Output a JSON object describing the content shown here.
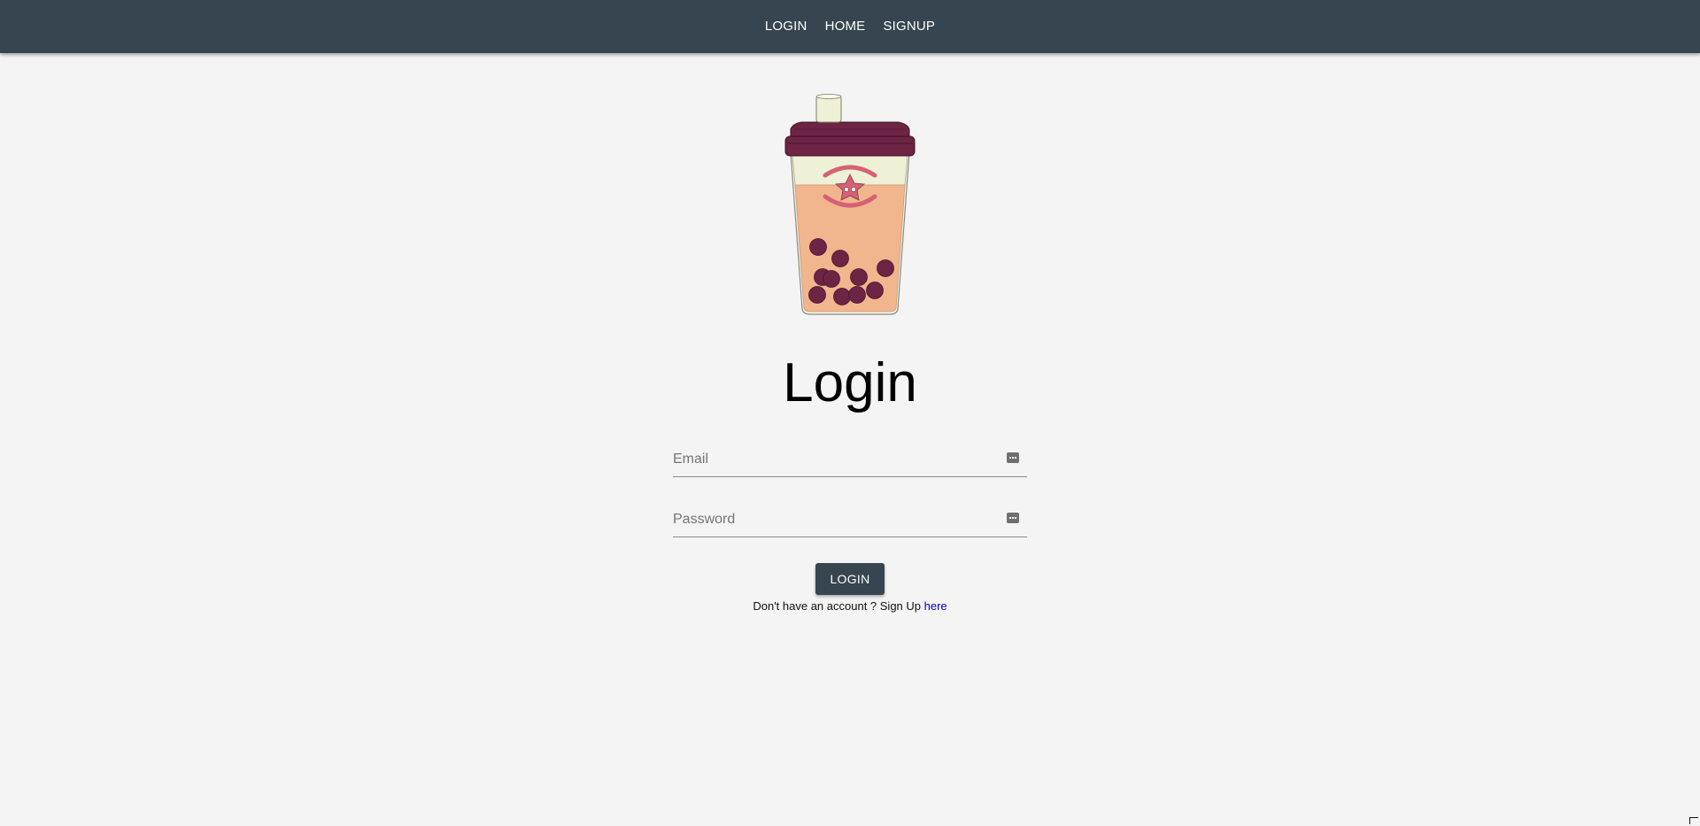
{
  "nav": {
    "items": [
      {
        "label": "LOGIN"
      },
      {
        "label": "HOME"
      },
      {
        "label": "SIGNUP"
      }
    ]
  },
  "logo": {
    "icon": "bubble-tea-cup-icon"
  },
  "page": {
    "title": "Login"
  },
  "form": {
    "email": {
      "placeholder": "Email",
      "value": ""
    },
    "password": {
      "placeholder": "Password",
      "value": ""
    },
    "submit_label": "LOGIN"
  },
  "signup_hint": {
    "text": "Don't have an account ? Sign Up ",
    "link_label": "here"
  },
  "colors": {
    "navbar": "#36454f",
    "background": "#f4f4f4",
    "button": "#36454f",
    "link": "#0000cc",
    "cup_lid": "#6e2444",
    "cup_tea": "#f1b68d",
    "cup_foam": "#eef1d6",
    "pearl": "#6e2444"
  }
}
